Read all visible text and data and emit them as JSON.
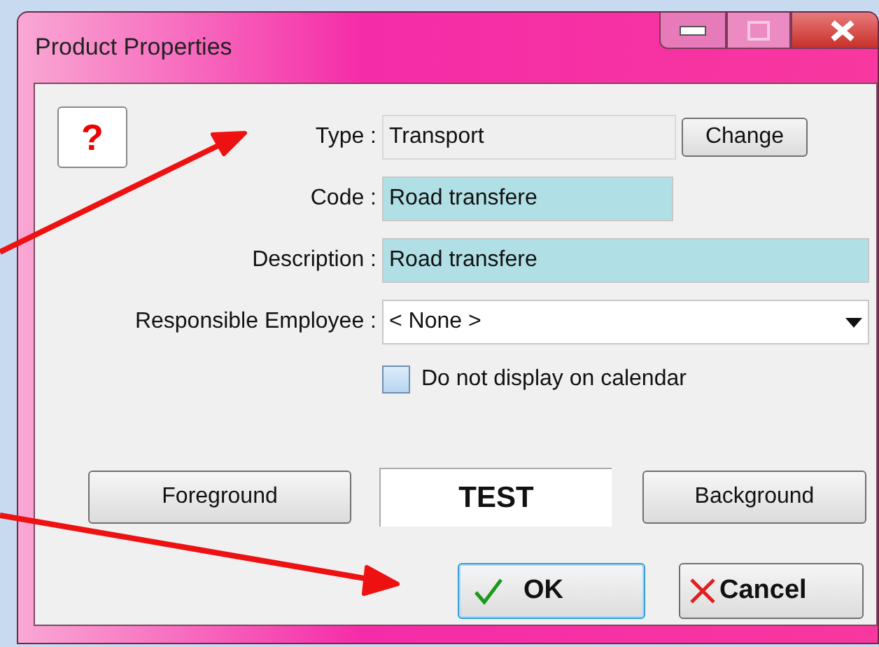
{
  "window": {
    "title": "Product Properties"
  },
  "help_button": {
    "label": "?"
  },
  "fields": [
    {
      "label": "Type :",
      "value": "Transport",
      "kind": "readonly",
      "highlighted": false,
      "action": "Change"
    },
    {
      "label": "Code :",
      "value": "Road transfere",
      "kind": "text",
      "highlighted": true
    },
    {
      "label": "Description :",
      "value": "Road transfere",
      "kind": "text",
      "highlighted": true
    },
    {
      "label": "Responsible Employee :",
      "value": "< None >",
      "kind": "dropdown",
      "highlighted": false
    }
  ],
  "checkbox": {
    "label": "Do not display on calendar",
    "checked": false
  },
  "color_buttons": [
    "Foreground",
    "Background"
  ],
  "preview": "TEST",
  "buttons": [
    {
      "label": "OK",
      "kind": "ok",
      "default": true
    },
    {
      "label": "Cancel",
      "kind": "cancel",
      "default": false
    }
  ]
}
